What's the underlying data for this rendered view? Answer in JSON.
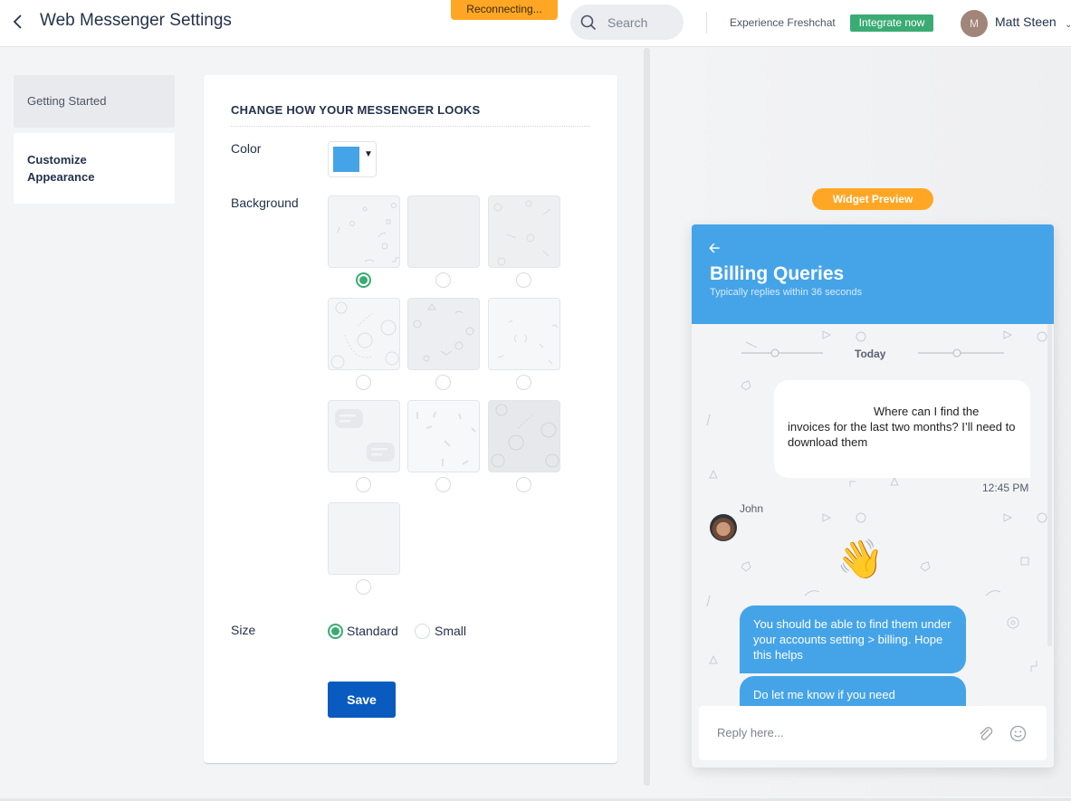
{
  "header": {
    "title": "Web Messenger Settings",
    "status_banner": "Reconnecting...",
    "search_placeholder": "Search",
    "promo_text": "Experience Freshchat",
    "integrate_label": "Integrate now",
    "user_initial": "M",
    "user_name": "Matt Steen"
  },
  "sidebar": {
    "items": [
      {
        "label": "Getting Started",
        "active": false
      },
      {
        "label": "Customize Appearance",
        "active": true
      }
    ]
  },
  "settings": {
    "section_title": "CHANGE HOW YOUR MESSENGER LOOKS",
    "color_label": "Color",
    "color_value": "#45a4e8",
    "background_label": "Background",
    "backgrounds": [
      {
        "pattern": "shapes",
        "selected": true
      },
      {
        "pattern": "texture",
        "selected": false
      },
      {
        "pattern": "doodles",
        "selected": false
      },
      {
        "pattern": "space",
        "selected": false
      },
      {
        "pattern": "icons",
        "selected": false
      },
      {
        "pattern": "squiggles",
        "selected": false
      },
      {
        "pattern": "chat-bubbles",
        "selected": false
      },
      {
        "pattern": "confetti",
        "selected": false
      },
      {
        "pattern": "space-dark",
        "selected": false
      },
      {
        "pattern": "plain",
        "selected": false
      }
    ],
    "size_label": "Size",
    "size_options": [
      {
        "label": "Standard",
        "selected": true
      },
      {
        "label": "Small",
        "selected": false
      }
    ],
    "save_label": "Save"
  },
  "preview": {
    "badge": "Widget Preview",
    "title": "Billing Queries",
    "subtitle": "Typically replies within 36 seconds",
    "date_separator": "Today",
    "messages": [
      {
        "from": "user",
        "text": "Where can I find the invoices for the last two months? I’ll need to download them",
        "time": "12:45 PM"
      },
      {
        "from": "agent",
        "name": "John",
        "text": "👋"
      },
      {
        "from": "agent",
        "text": "You should be able to find them under your accounts setting > billing. Hope this helps"
      },
      {
        "from": "agent",
        "text": "Do let me know if you need"
      }
    ],
    "reply_placeholder": "Reply here..."
  },
  "colors": {
    "accent_blue": "#45a4e8",
    "save_blue": "#0a5bbf",
    "green": "#3bab74",
    "orange": "#ffa724"
  }
}
